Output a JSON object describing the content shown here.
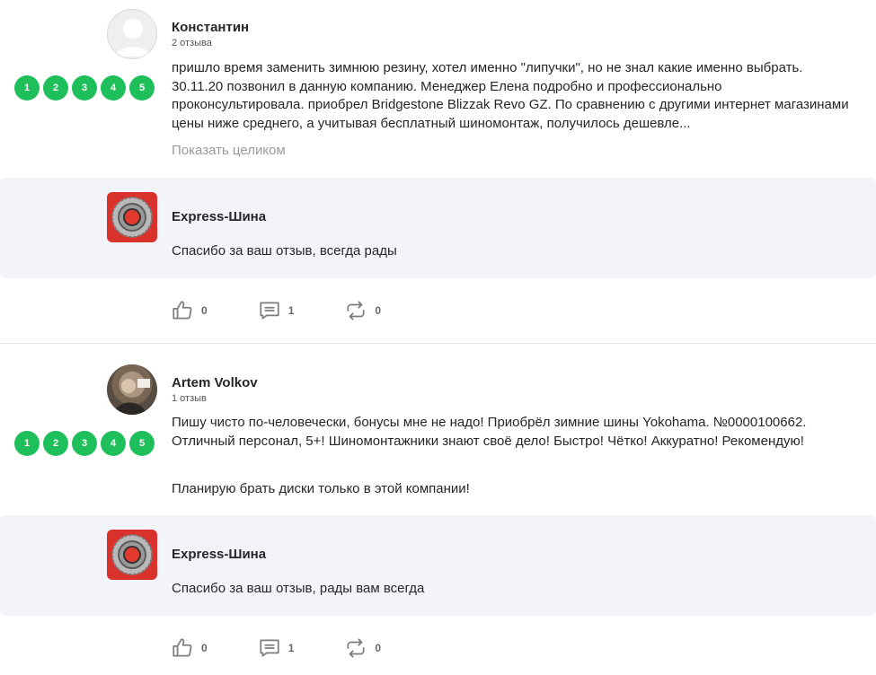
{
  "reviews": [
    {
      "author": "Константин",
      "reviews_count": "2 отзыва",
      "rating": [
        "1",
        "2",
        "3",
        "4",
        "5"
      ],
      "text": "пришло время заменить зимнюю резину, хотел именно \"липучки\", но не знал какие именно выбрать. 30.11.20 позвонил в данную компанию. Менеджер Елена подробно и профессионально проконсультировала. приобрел Bridgestone Blizzak Revo GZ. По сравнению с другими интернет магазинами цены ниже среднего, а учитывая бесплатный шиномонтаж, получилось дешевле...",
      "show_more": "Показать целиком",
      "reply": {
        "company": "Express-Шина",
        "text": "Спасибо за ваш отзыв, всегда рады"
      },
      "likes": "0",
      "comments": "1",
      "reposts": "0"
    },
    {
      "author": "Artem Volkov",
      "reviews_count": "1 отзыв",
      "rating": [
        "1",
        "2",
        "3",
        "4",
        "5"
      ],
      "text": "Пишу чисто по-человечески, бонусы мне не надо! Приобрёл зимние шины Yokohama. №0000100662. Отличный персонал, 5+! Шиномонтажники знают своё дело! Быстро! Чётко! Аккуратно! Рекомендую!",
      "text2": "Планирую брать диски только в этой компании!",
      "reply": {
        "company": "Express-Шина",
        "text": "Спасибо за ваш отзыв, рады вам всегда"
      },
      "likes": "0",
      "comments": "1",
      "reposts": "0"
    }
  ],
  "colors": {
    "rating_green": "#1fbf5b",
    "reply_bg": "#f3f4f9",
    "logo_red": "#d9312c"
  },
  "icons": [
    "avatar-icon",
    "tire-logo-icon",
    "like-icon",
    "comment-icon",
    "repost-icon"
  ]
}
